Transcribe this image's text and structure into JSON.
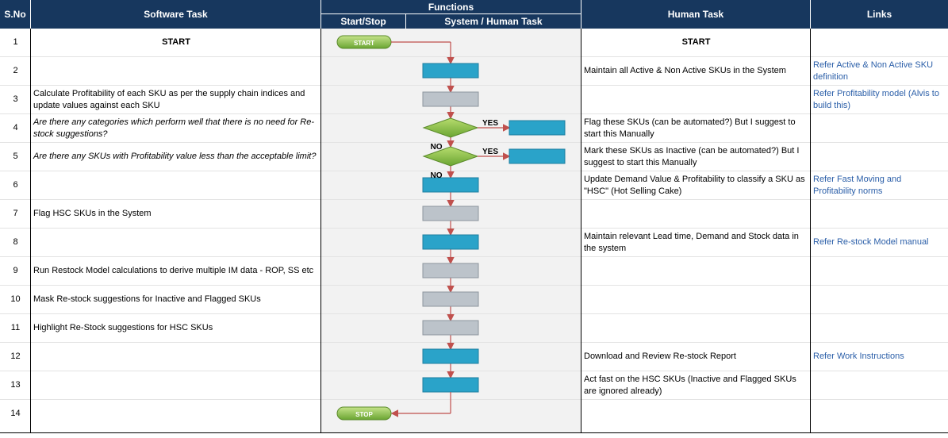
{
  "header": {
    "sno": "S.No",
    "software_task": "Software Task",
    "functions": "Functions",
    "start_stop": "Start/Stop",
    "system_human": "System / Human Task",
    "human_task": "Human Task",
    "links": "Links"
  },
  "rows": [
    {
      "no": "1",
      "software": "START",
      "human": "START",
      "link": ""
    },
    {
      "no": "2",
      "software": "",
      "human": "Maintain all Active & Non Active SKUs in the System",
      "link": "Refer Active & Non Active SKU definition"
    },
    {
      "no": "3",
      "software": "Calculate Profitability of each SKU as per the supply chain indices and update values against each SKU",
      "human": "",
      "link": "Refer Profitability model (Alvis to build this)"
    },
    {
      "no": "4",
      "software": "Are there any categories which perform well that there is no need for Re-stock suggestions?",
      "human": "Flag these SKUs (can be automated?) But I suggest to start this Manually",
      "link": ""
    },
    {
      "no": "5",
      "software": "Are there any SKUs with Profitability value less than the acceptable limit?",
      "human": "Mark these SKUs as Inactive (can be automated?) But I suggest to start this Manually",
      "link": ""
    },
    {
      "no": "6",
      "software": "",
      "human": "Update Demand Value & Profitability to classify a SKU as \"HSC\" (Hot Selling Cake)",
      "link": "Refer Fast Moving and Profitability norms"
    },
    {
      "no": "7",
      "software": "Flag HSC SKUs in the System",
      "human": "",
      "link": ""
    },
    {
      "no": "8",
      "software": "",
      "human": "Maintain relevant Lead time, Demand and Stock data in the system",
      "link": "Refer Re-stock Model manual"
    },
    {
      "no": "9",
      "software": "Run Restock Model calculations to derive multiple IM data - ROP, SS etc",
      "human": "",
      "link": ""
    },
    {
      "no": "10",
      "software": "Mask Re-stock suggestions for Inactive and Flagged SKUs",
      "human": "",
      "link": ""
    },
    {
      "no": "11",
      "software": "Highlight Re-Stock suggestions for HSC SKUs",
      "human": "",
      "link": ""
    },
    {
      "no": "12",
      "software": "",
      "human": "Download and Review Re-stock Report",
      "link": "Refer Work Instructions"
    },
    {
      "no": "13",
      "software": "",
      "human": "Act fast on the HSC SKUs (Inactive and Flagged SKUs are ignored already)",
      "link": ""
    },
    {
      "no": "14",
      "software": "",
      "human": "",
      "link": ""
    }
  ],
  "flow": {
    "start_label": "START",
    "stop_label": "STOP",
    "yes_label": "YES",
    "no_label": "NO",
    "colors": {
      "human_box": "#2aa3c9",
      "system_box": "#bcc3ca",
      "terminal": "#92c445",
      "decision": "#8cc63f",
      "arrow": "#c0504d"
    }
  }
}
